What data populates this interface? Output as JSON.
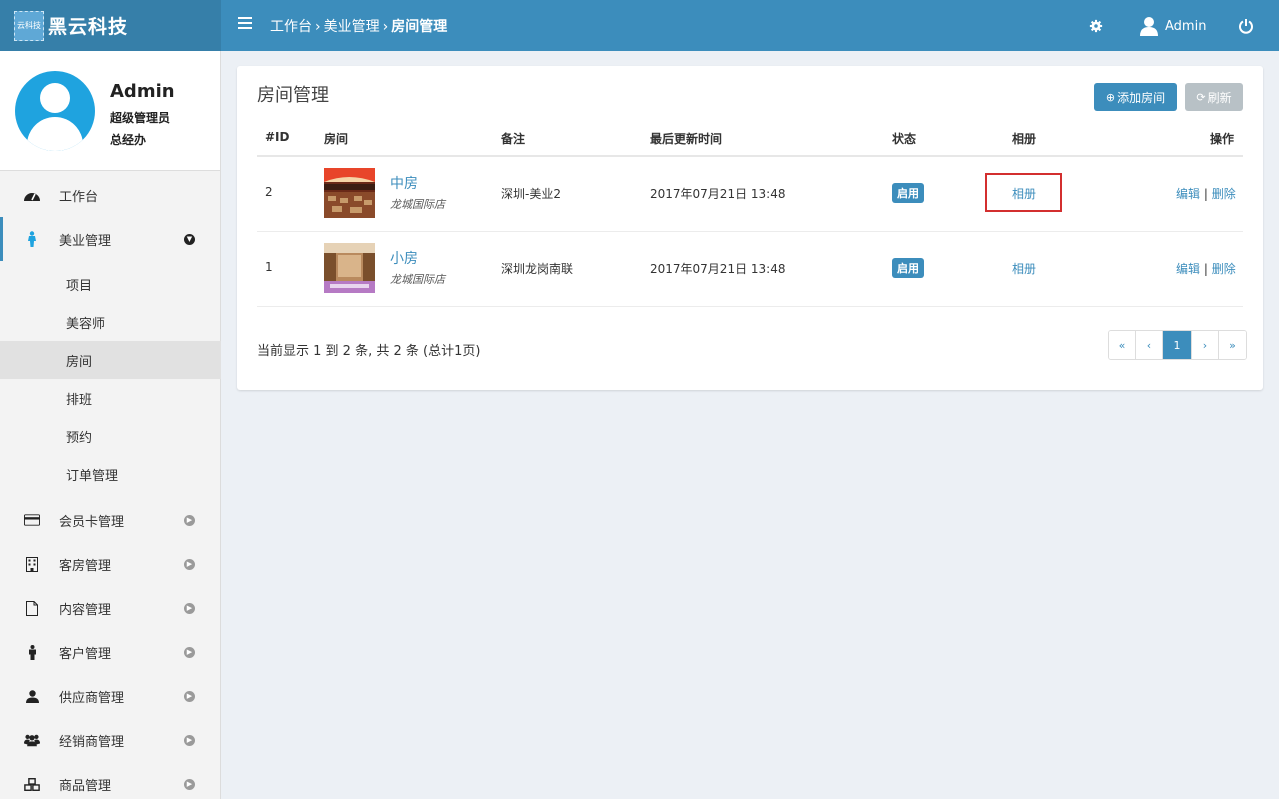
{
  "brand": {
    "logo_text": "黑云科技",
    "badge_text": "云科技"
  },
  "topbar": {
    "breadcrumb": [
      "工作台",
      "美业管理",
      "房间管理"
    ],
    "breadcrumb_sep": "›",
    "user_label": "Admin",
    "icons": {
      "menu": "hamburger-icon",
      "settings": "gear-icon",
      "user": "user-icon",
      "logout": "power-icon"
    },
    "accent_color": "#3c8dbc"
  },
  "user_panel": {
    "name": "Admin",
    "role": "超级管理员",
    "department": "总经办"
  },
  "sidebar": {
    "items": [
      {
        "label": "工作台",
        "icon": "dashboard-icon"
      },
      {
        "label": "美业管理",
        "icon": "person-icon",
        "expanded": true
      },
      {
        "label": "会员卡管理",
        "icon": "credit-card-icon"
      },
      {
        "label": "客房管理",
        "icon": "building-icon"
      },
      {
        "label": "内容管理",
        "icon": "file-icon"
      },
      {
        "label": "客户管理",
        "icon": "male-icon"
      },
      {
        "label": "供应商管理",
        "icon": "user-icon"
      },
      {
        "label": "经销商管理",
        "icon": "users-icon"
      },
      {
        "label": "商品管理",
        "icon": "cubes-icon"
      }
    ],
    "submenu": [
      {
        "label": "项目"
      },
      {
        "label": "美容师"
      },
      {
        "label": "房间",
        "active": true
      },
      {
        "label": "排班"
      },
      {
        "label": "预约"
      },
      {
        "label": "订单管理"
      }
    ]
  },
  "main": {
    "title": "房间管理",
    "add_button": "添加房间",
    "refresh_button": "刷新",
    "columns": [
      "#ID",
      "房间",
      "备注",
      "最后更新时间",
      "状态",
      "相册",
      "操作"
    ],
    "rows": [
      {
        "id": "2",
        "room": "中房",
        "store": "龙城国际店",
        "note": "深圳-美业2",
        "updated": "2017年07月21日 13:48",
        "status": "启用",
        "album": "相册",
        "edit": "编辑",
        "delete": "删除"
      },
      {
        "id": "1",
        "room": "小房",
        "store": "龙城国际店",
        "note": "深圳龙岗南联",
        "updated": "2017年07月21日 13:48",
        "status": "启用",
        "album": "相册",
        "edit": "编辑",
        "delete": "删除"
      }
    ],
    "ops_sep": "|",
    "summary": "当前显示 1 到 2 条, 共 2 条 (总计1页)",
    "pagination": [
      "«",
      "‹",
      "1",
      "›",
      "»"
    ],
    "current_page": "1"
  }
}
